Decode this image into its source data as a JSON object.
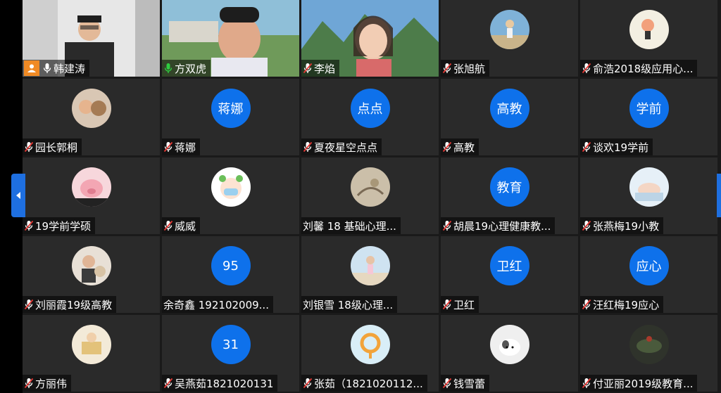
{
  "participants": [
    {
      "name": "韩建涛",
      "type": "video",
      "mic": "on",
      "host": true
    },
    {
      "name": "方双虎",
      "type": "video",
      "mic": "active"
    },
    {
      "name": "李焰",
      "type": "video",
      "mic": "muted"
    },
    {
      "name": "张旭航",
      "type": "photo",
      "mic": "muted",
      "avatar": "person-outdoor"
    },
    {
      "name": "俞浩2018级应用心...",
      "type": "photo",
      "mic": "muted",
      "avatar": "cartoon-figure"
    },
    {
      "name": "园长郭桐",
      "type": "photo",
      "mic": "muted",
      "avatar": "child-with-dog"
    },
    {
      "name": "蒋娜",
      "type": "text",
      "mic": "muted",
      "initials": "蒋娜"
    },
    {
      "name": "夏夜星空点点",
      "type": "text",
      "mic": "muted",
      "initials": "点点"
    },
    {
      "name": "高教",
      "type": "text",
      "mic": "muted",
      "initials": "高教"
    },
    {
      "name": "谈欢19学前",
      "type": "text",
      "mic": "muted",
      "initials": "学前"
    },
    {
      "name": "19学前学硕",
      "type": "photo",
      "mic": "muted",
      "avatar": "pink-pig"
    },
    {
      "name": "威威",
      "type": "photo",
      "mic": "muted",
      "avatar": "masked-cartoon"
    },
    {
      "name": "刘馨 18 基础心理...",
      "type": "photo",
      "mic": "none",
      "avatar": "sketch"
    },
    {
      "name": "胡晨19心理健康教...",
      "type": "text",
      "mic": "muted",
      "initials": "教育"
    },
    {
      "name": "张燕梅19小教",
      "type": "photo",
      "mic": "muted",
      "avatar": "sleeping-baby"
    },
    {
      "name": "刘丽霞19级高教",
      "type": "photo",
      "mic": "muted",
      "avatar": "woman-with-cat"
    },
    {
      "name": "余奇鑫 192102009...",
      "type": "text",
      "mic": "none",
      "initials": "95"
    },
    {
      "name": "刘银雪  18级心理...",
      "type": "photo",
      "mic": "none",
      "avatar": "girl-beach"
    },
    {
      "name": "卫红",
      "type": "text",
      "mic": "muted",
      "initials": "卫红"
    },
    {
      "name": "汪红梅19应心",
      "type": "text",
      "mic": "muted",
      "initials": "应心"
    },
    {
      "name": "方丽伟",
      "type": "photo",
      "mic": "muted",
      "avatar": "building-cartoon"
    },
    {
      "name": "吴燕茹1821020131",
      "type": "text",
      "mic": "muted",
      "initials": "31"
    },
    {
      "name": "张茹（1821020112...",
      "type": "photo",
      "mic": "muted",
      "avatar": "orange-ring"
    },
    {
      "name": "钱雪蕾",
      "type": "photo",
      "mic": "muted",
      "avatar": "white-cat"
    },
    {
      "name": "付亚丽2019级教育...",
      "type": "photo",
      "mic": "muted",
      "avatar": "dark-landscape"
    }
  ],
  "colors": {
    "tile_bg": "#2a2a2a",
    "text_avatar": "#0e71eb",
    "host_badge": "#f08a24",
    "muted_mic": "#e53935",
    "active_mic": "#2ecc40",
    "nav_arrow": "#1e6fe0"
  }
}
